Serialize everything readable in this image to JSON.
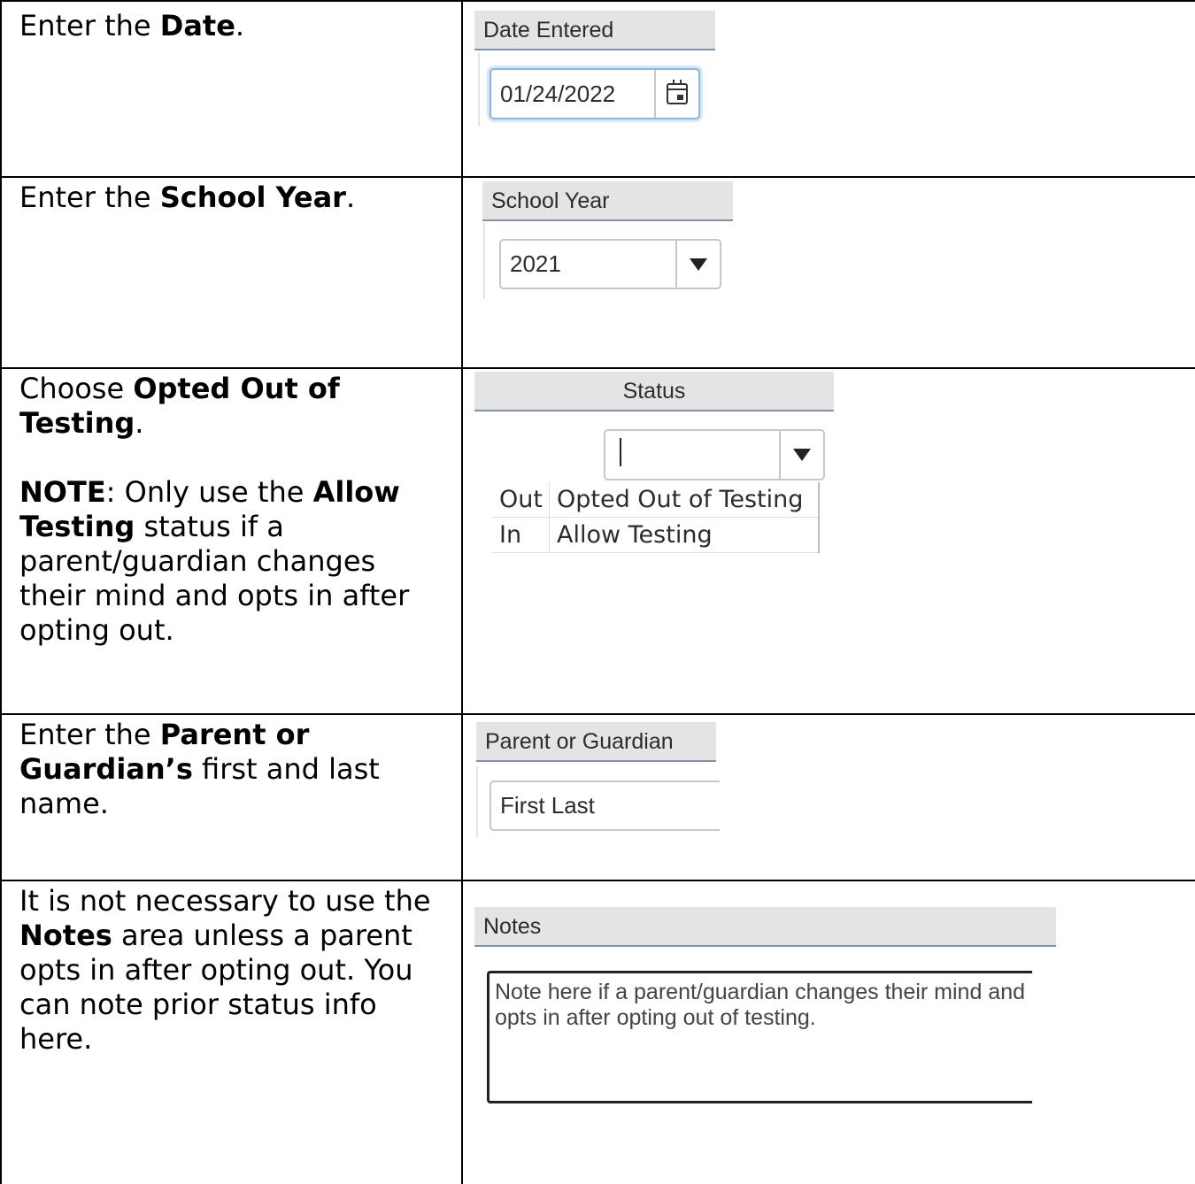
{
  "rows": [
    {
      "instruction": {
        "pre": "Enter the ",
        "bold": "Date",
        "post": "."
      },
      "field_header": "Date Entered",
      "field_value": "01/24/2022",
      "field_icon": "calendar-icon"
    },
    {
      "instruction": {
        "pre": "Enter the ",
        "bold": "School Year",
        "post": "."
      },
      "field_header": "School Year",
      "field_value": "2021",
      "field_icon": "dropdown-arrow-icon"
    },
    {
      "instruction": {
        "pre": "Choose ",
        "bold": "Opted Out of Testing",
        "post": ".",
        "note_label": "NOTE",
        "note_pre": ": Only use the ",
        "note_bold": "Allow Testing",
        "note_post": " status if a parent/guardian changes their mind and opts in after opting out."
      },
      "field_header": "Status",
      "field_value": "",
      "field_icon": "dropdown-arrow-icon",
      "options": [
        {
          "code": "Out",
          "label": "Opted Out of Testing"
        },
        {
          "code": "In",
          "label": "Allow Testing"
        }
      ]
    },
    {
      "instruction": {
        "pre": "Enter the ",
        "bold": "Parent or Guardian’s",
        "post": " first and last name."
      },
      "field_header": "Parent or Guardian",
      "field_value": "First Last"
    },
    {
      "instruction": {
        "pre": "It is not necessary to use the ",
        "bold": "Notes",
        "post": " area unless a parent opts in after opting out. You can note prior status info here."
      },
      "field_header": "Notes",
      "field_value": "Note here if a parent/guardian changes their mind and opts in after opting out of testing."
    }
  ]
}
